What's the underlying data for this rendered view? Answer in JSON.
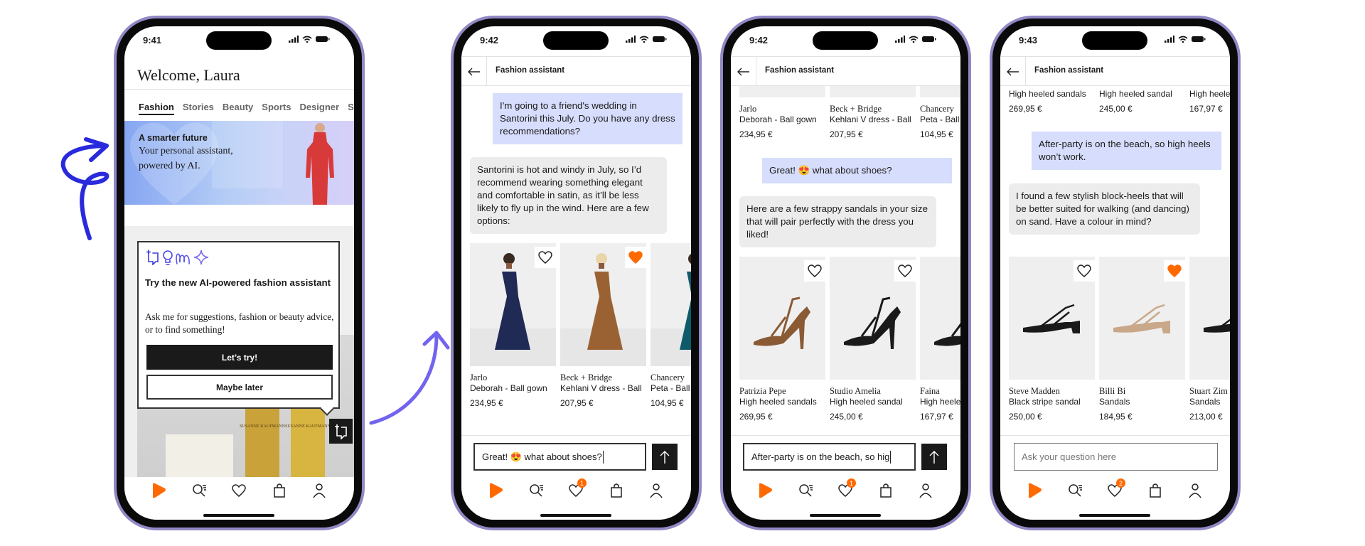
{
  "colors": {
    "phone_frame": "#9089c5",
    "accent_orange": "#ff6900",
    "user_bubble": "#d7ddfc",
    "assistant_bubble": "#ececec",
    "arrow_blue": "#2a2add",
    "arrow_purple": "#7264ee"
  },
  "home_screen": {
    "time": "9:41",
    "welcome": "Welcome, Laura",
    "tabs": [
      "Fashion",
      "Stories",
      "Beauty",
      "Sports",
      "Designer",
      "S"
    ],
    "active_tab": "Fashion",
    "banner": {
      "title": "A smarter future",
      "line1": "Your personal assistant,",
      "line2": "powered by AI."
    },
    "popup": {
      "icons": [
        "sparkle-chat-icon",
        "lightbulb-icon",
        "squiggle-icon",
        "sparkle-icon"
      ],
      "title": "Try the new AI-powered fashion assistant",
      "body": "Ask me for suggestions, fashion or beauty advice, or to find something!",
      "primary": "Let’s try!",
      "secondary": "Maybe later"
    },
    "product_label": "SUSANNE KAUFMANN",
    "nav": [
      "home-icon",
      "search-icon",
      "wishlist-icon",
      "bag-icon",
      "profile-icon"
    ]
  },
  "chat_screens": [
    {
      "time": "9:42",
      "title": "Fashion assistant",
      "wishlist_count": "1",
      "top_products": [],
      "user_message": "I'm going to a friend's wedding in Santorini this July. Do you have any dress recommendations?",
      "assistant_message": "Santorini is hot and windy in July, so I’d recommend wearing something elegant and comfortable in satin, as it’ll be less likely to fly up in the wind. Here are a few options:",
      "products": [
        {
          "brand": "Jarlo",
          "name": "Deborah - Ball gown",
          "price": "234,95 €",
          "liked": false,
          "color": "#1f2a55"
        },
        {
          "brand": "Beck + Bridge",
          "name": "Kehlani V dress - Ball",
          "price": "207,95 €",
          "liked": true,
          "color": "#9a6233"
        },
        {
          "brand": "Chancery",
          "name": "Peta - Ball",
          "price": "104,95 €",
          "liked": false,
          "color": "#0f5a6a"
        }
      ],
      "input": {
        "value": "Great! 😍 what about shoes?",
        "placeholder": ""
      }
    },
    {
      "time": "9:42",
      "title": "Fashion assistant",
      "wishlist_count": "1",
      "top_products": [
        {
          "brand": "Jarlo",
          "name": "Deborah - Ball gown",
          "price": "234,95 €"
        },
        {
          "brand": "Beck + Bridge",
          "name": "Kehlani V dress - Ball",
          "price": "207,95 €"
        },
        {
          "brand": "Chancery",
          "name": "Peta - Ball",
          "price": "104,95 €"
        }
      ],
      "user_message": "Great! 😍 what about shoes?",
      "assistant_message": "Here are a few strappy sandals in your size that will pair perfectly with the dress you liked!",
      "products": [
        {
          "brand": "Patrizia Pepe",
          "name": "High heeled sandals",
          "price": "269,95 €",
          "liked": false,
          "color": "#8a5a35"
        },
        {
          "brand": "Studio Amelia",
          "name": "High heeled sandal",
          "price": "245,00 €",
          "liked": false,
          "color": "#1a1a1a"
        },
        {
          "brand": "Faina",
          "name": "High heele",
          "price": "167,97 €",
          "liked": false,
          "color": "#1a1a1a"
        }
      ],
      "input": {
        "value": "After-party is on the beach, so hig",
        "placeholder": ""
      }
    },
    {
      "time": "9:43",
      "title": "Fashion assistant",
      "wishlist_count": "2",
      "top_products": [
        {
          "brand": "",
          "name": "High heeled sandals",
          "price": "269,95 €"
        },
        {
          "brand": "",
          "name": "High heeled sandal",
          "price": "245,00 €"
        },
        {
          "brand": "",
          "name": "High heele",
          "price": "167,97 €"
        }
      ],
      "user_message": "After-party is on the beach, so high heels won’t work.",
      "assistant_message": "I found a few stylish block-heels that will be better suited for walking (and dancing) on sand. Have a colour in mind?",
      "products": [
        {
          "brand": "Steve Madden",
          "name": "Black stripe sandal",
          "price": "250,00 €",
          "liked": false,
          "color": "#1a1a1a"
        },
        {
          "brand": "Billi Bi",
          "name": "Sandals",
          "price": "184,95 €",
          "liked": true,
          "color": "#c9a88a"
        },
        {
          "brand": "Stuart Zim",
          "name": "Sandals",
          "price": "213,00 €",
          "liked": false,
          "color": "#1a1a1a"
        }
      ],
      "input": {
        "value": "",
        "placeholder": "Ask your question here"
      }
    }
  ]
}
